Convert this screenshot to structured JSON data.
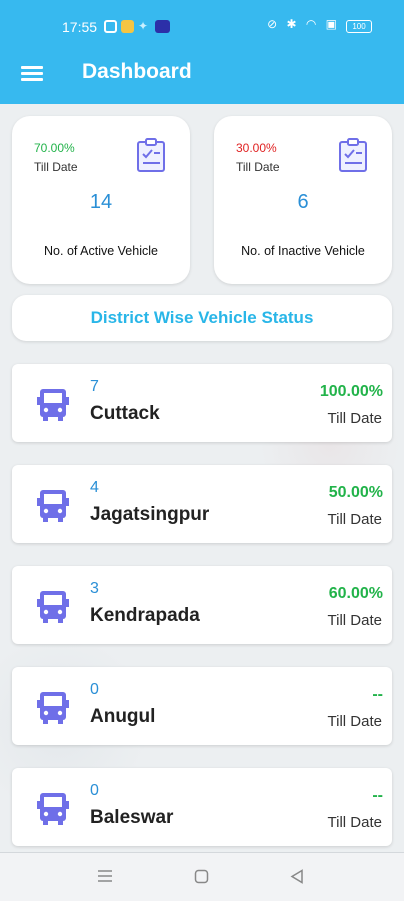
{
  "status_bar": {
    "time": "17:55",
    "battery": "100"
  },
  "header": {
    "title": "Dashboard"
  },
  "stats": [
    {
      "percent": "70.00%",
      "percent_color": "#22b34a",
      "subtitle": "Till Date",
      "count": "14",
      "label": "No. of Active Vehicle"
    },
    {
      "percent": "30.00%",
      "percent_color": "#e02222",
      "subtitle": "Till Date",
      "count": "6",
      "label": "No. of Inactive Vehicle"
    }
  ],
  "section_title": "District Wise Vehicle Status",
  "districts": [
    {
      "count": "7",
      "name": "Cuttack",
      "percent": "100.00%",
      "till": "Till Date"
    },
    {
      "count": "4",
      "name": "Jagatsingpur",
      "percent": "50.00%",
      "till": "Till Date"
    },
    {
      "count": "3",
      "name": "Kendrapada",
      "percent": "60.00%",
      "till": "Till Date"
    },
    {
      "count": "0",
      "name": "Anugul",
      "percent": "--",
      "till": "Till Date"
    },
    {
      "count": "0",
      "name": "Baleswar",
      "percent": "--",
      "till": "Till Date"
    }
  ],
  "colors": {
    "header": "#37b9ef",
    "accent": "#29b6e8",
    "bus_icon": "#6f6fe8",
    "positive": "#22b34a",
    "negative": "#e02222"
  },
  "icons": {
    "menu": "hamburger-icon",
    "stat": "clipboard-icon",
    "vehicle": "bus-icon",
    "nav": [
      "menu-nav-icon",
      "home-nav-icon",
      "back-nav-icon"
    ]
  }
}
